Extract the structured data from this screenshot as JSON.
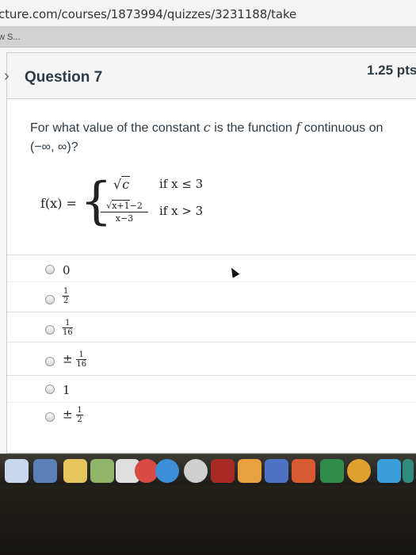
{
  "browser": {
    "url": "cture.com/courses/1873994/quizzes/3231188/take",
    "bookmark": "w S..."
  },
  "question": {
    "title": "Question 7",
    "points": "1.25 pts",
    "text_before_c": "For what value of the constant ",
    "c_symbol": "c",
    "text_mid": " is the function ",
    "f_symbol": "f",
    "text_after": " continuous on",
    "interval": "(−∞, ∞)?"
  },
  "formula": {
    "lhs": "f(x) =",
    "case1_value_var": "c",
    "case1_condition": "if  x ≤ 3",
    "case2_numerator_sqrt": "x+1",
    "case2_numerator_rest": "−2",
    "case2_denominator": "x−3",
    "case2_condition": "if  x > 3"
  },
  "answers": [
    {
      "label": "0"
    },
    {
      "prefix": "",
      "num": "1",
      "den": "2"
    },
    {
      "prefix": "",
      "num": "1",
      "den": "16"
    },
    {
      "prefix": "±",
      "num": "1",
      "den": "16"
    },
    {
      "label": "1"
    },
    {
      "prefix": "±",
      "num": "1",
      "den": "2"
    }
  ],
  "dock_icons": [
    "itunes-icon",
    "photo-icon",
    "preview-icon",
    "notes-icon",
    "calendar-icon",
    "messages-icon",
    "facetime-icon",
    "safari-icon",
    "photo-booth-icon",
    "pdf-icon",
    "books-icon",
    "textedit-icon",
    "word-icon",
    "powerpoint-icon",
    "excel-icon",
    "onenote-icon",
    "app-store-icon"
  ],
  "colors": {
    "page_bg": "#f6f6f4",
    "card_header": "#f5f5f5",
    "text": "#2d3b45",
    "dock": "#2e2b26"
  }
}
